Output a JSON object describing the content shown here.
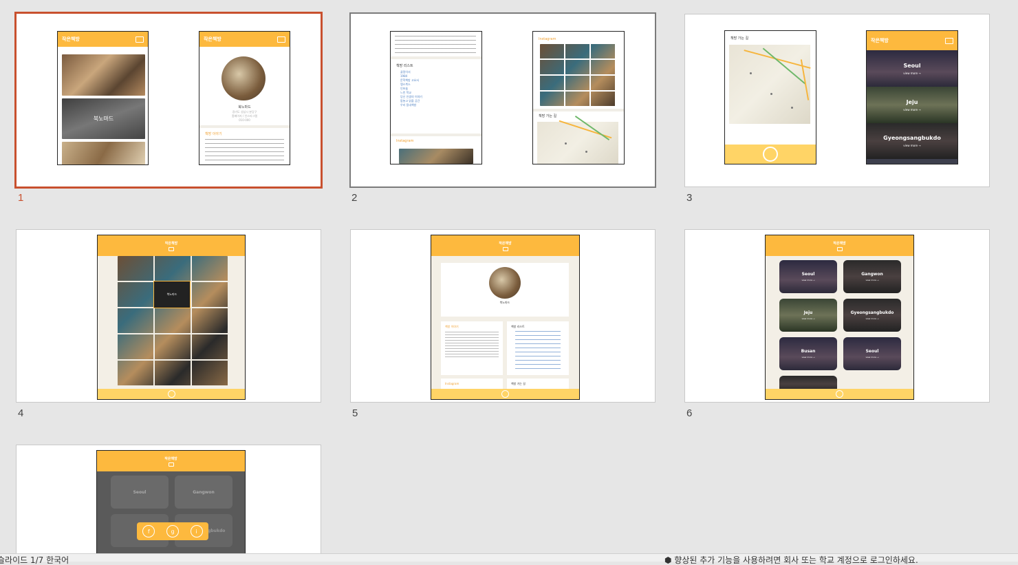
{
  "app": {
    "title": "PowerPoint slide sorter"
  },
  "slides": [
    {
      "number": "1",
      "selected": true
    },
    {
      "number": "2"
    },
    {
      "number": "3"
    },
    {
      "number": "4"
    },
    {
      "number": "5"
    },
    {
      "number": "6"
    },
    {
      "number": "7"
    }
  ],
  "mock": {
    "brand": "작은책방",
    "bookstore_name": "북노마드",
    "story_title": "책방 이야기",
    "list_title": "책방 리스트",
    "instagram": "Instagram",
    "directions": "책방 가는 길",
    "view_more": "view more →",
    "regions_s3": [
      "Seoul",
      "Jeju",
      "Gyeongsangbukdo"
    ],
    "regions_s6": [
      "Seoul",
      "Gangwon",
      "Jeju",
      "Gyeongsangbukdo",
      "Busan",
      "Seoul"
    ],
    "regions_s7": [
      "Seoul",
      "Gangwon",
      "Gyeongsangbukdo"
    ],
    "social": [
      "f",
      "g",
      "i"
    ],
    "store_addr": [
      "경기도 성남시 분당구",
      "홈페이지 / 인스타그램",
      "010-000"
    ],
    "list_items": [
      "굴렁이서",
      "1984",
      "문학책방 고요서",
      "땡스북스",
      "인포숍",
      "느린 학교",
      "당신 인생의 이야기",
      "맘놓고 읽을 공간",
      "우리 동네책방"
    ]
  },
  "status": {
    "left": "슬라이드 1/7 한국어",
    "right": "⬢ 향상된 추가 기능을 사용하려면 회사 또는 학교 계정으로 로그인하세요."
  }
}
